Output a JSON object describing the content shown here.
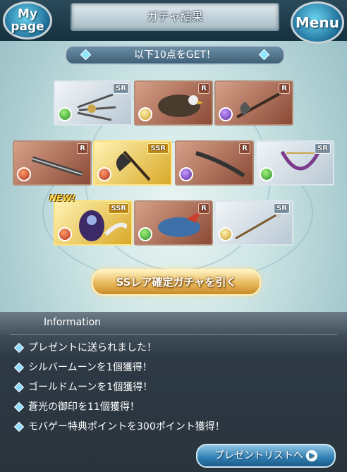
{
  "header": {
    "title": "ガチャ結果",
    "mypage_label": "My page",
    "menu_label": "Menu"
  },
  "results": {
    "banner": "以下10点をGET！",
    "new_badge": "NEW!",
    "cards": [
      {
        "rarity": "SR",
        "element": "wind",
        "item": "triple-claw-weapon"
      },
      {
        "rarity": "R",
        "element": "light",
        "item": "eagle-summon"
      },
      {
        "rarity": "R",
        "element": "dark",
        "item": "axe"
      },
      {
        "rarity": "R",
        "element": "fire",
        "item": "greatsword"
      },
      {
        "rarity": "SSR",
        "element": "fire",
        "item": "battle-axe"
      },
      {
        "rarity": "R",
        "element": "dark",
        "item": "curved-blade"
      },
      {
        "rarity": "SR",
        "element": "wind",
        "item": "harp"
      },
      {
        "rarity": "SSR",
        "element": "fire",
        "item": "dark-knight-summon"
      },
      {
        "rarity": "R",
        "element": "wind",
        "item": "dragon-summon"
      },
      {
        "rarity": "SR",
        "element": "light",
        "item": "spear"
      }
    ]
  },
  "ss_button": "SSレア確定ガチャを引く",
  "information": {
    "title": "Information",
    "items": [
      "プレゼントに送られました！",
      "シルバームーンを1個獲得！",
      "ゴールドムーンを1個獲得！",
      "蒼光の御印を11個獲得！",
      "モバゲー特典ポイントを300ポイント獲得！"
    ]
  },
  "present_button": "プレゼントリストへ"
}
